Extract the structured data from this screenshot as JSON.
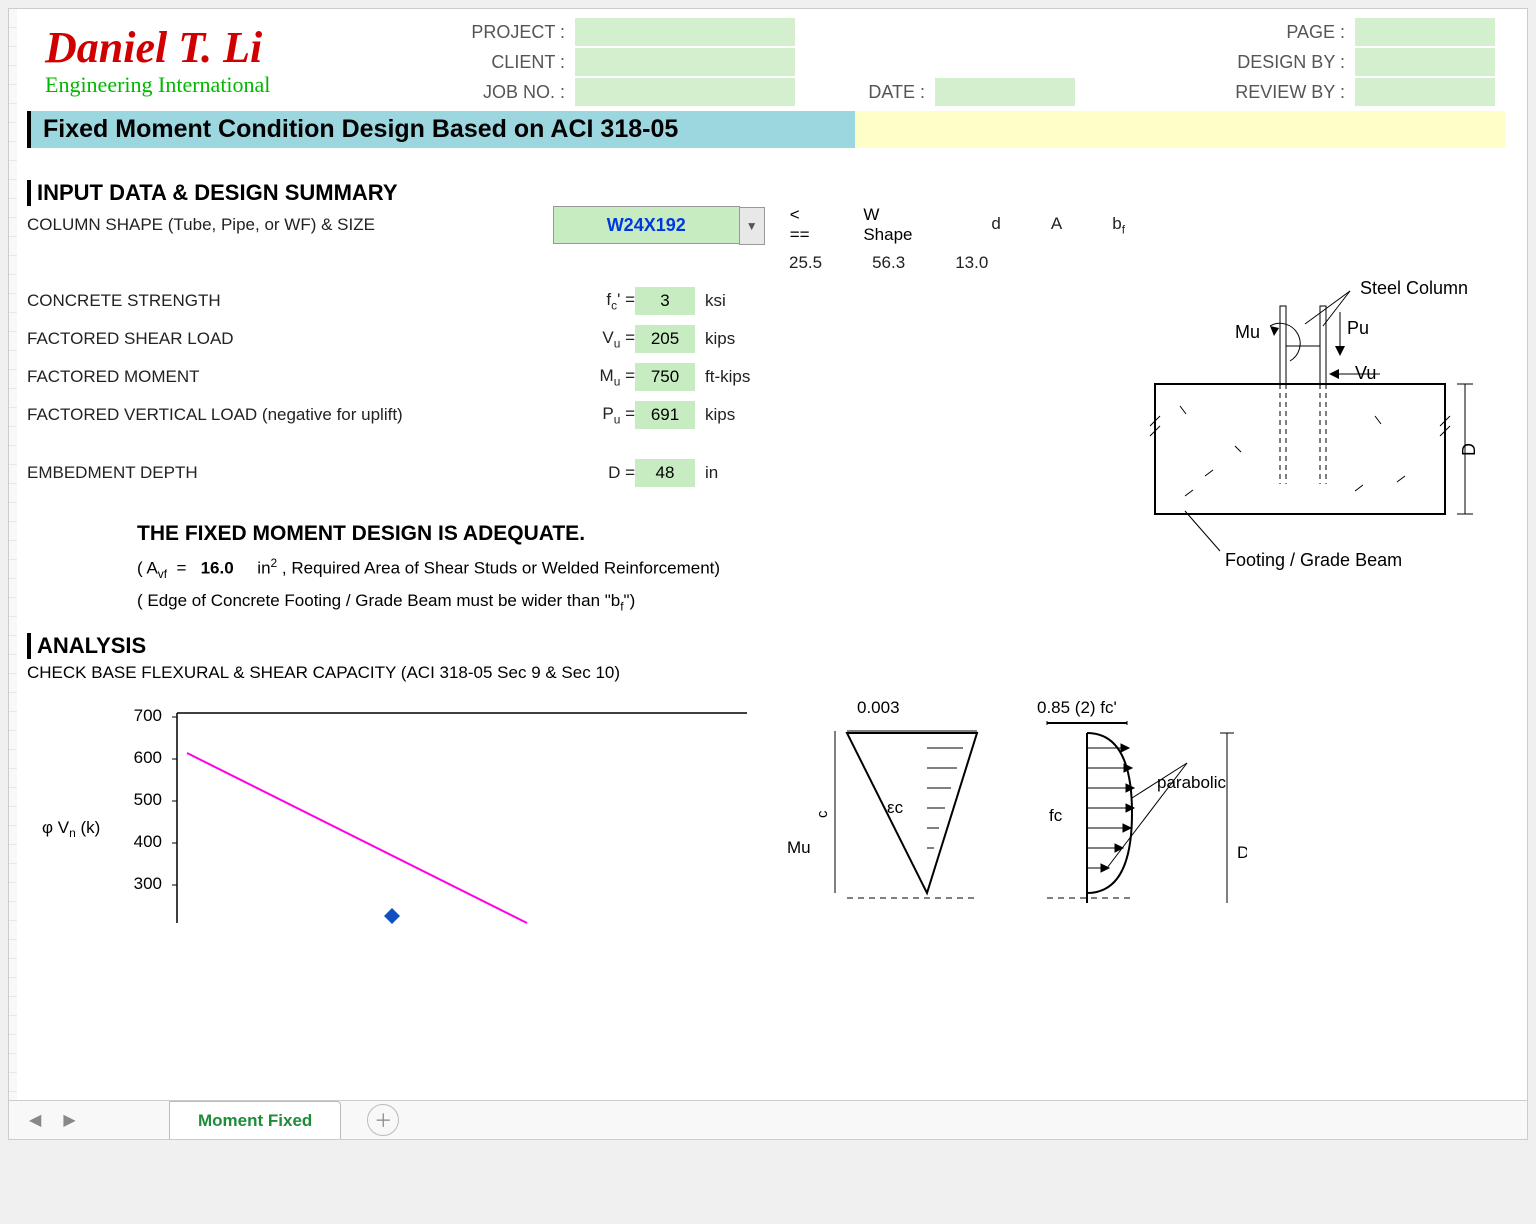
{
  "logo": {
    "name": "Daniel T. Li",
    "tagline": "Engineering International"
  },
  "header": {
    "project_label": "PROJECT :",
    "client_label": "CLIENT :",
    "jobno_label": "JOB NO. :",
    "date_label": "DATE :",
    "page_label": "PAGE :",
    "designby_label": "DESIGN BY :",
    "reviewby_label": "REVIEW BY :",
    "project": "",
    "client": "",
    "jobno": "",
    "date": "",
    "page": "",
    "designby": "",
    "reviewby": ""
  },
  "title": "Fixed Moment Condition Design Based on ACI 318-05",
  "sections": {
    "input": "INPUT DATA & DESIGN SUMMARY",
    "analysis": "ANALYSIS",
    "analysis_sub": "CHECK BASE FLEXURAL & SHEAR CAPACITY (ACI 318-05 Sec 9 & Sec 10)"
  },
  "inputs": {
    "shape_label": "COLUMN SHAPE (Tube, Pipe, or WF) & SIZE",
    "shape_value": "W24X192",
    "shape_arrow": "< ==",
    "shape_type": "W Shape",
    "props_hdr": {
      "d": "d",
      "A": "A",
      "bf": "bf"
    },
    "props_val": {
      "d": "25.5",
      "A": "56.3",
      "bf": "13.0"
    },
    "fc": {
      "label": "CONCRETE STRENGTH",
      "sym": "fc' =",
      "val": "3",
      "unit": "ksi"
    },
    "vu": {
      "label": "FACTORED SHEAR LOAD",
      "sym": "Vu =",
      "val": "205",
      "unit": "kips"
    },
    "mu": {
      "label": "FACTORED MOMENT",
      "sym": "Mu =",
      "val": "750",
      "unit": "ft-kips"
    },
    "pu": {
      "label": "FACTORED VERTICAL LOAD (negative for uplift)",
      "sym": "Pu =",
      "val": "691",
      "unit": "kips"
    },
    "d": {
      "label": "EMBEDMENT DEPTH",
      "sym": "D =",
      "val": "48",
      "unit": "in"
    }
  },
  "result": {
    "headline": "THE FIXED MOMENT DESIGN IS ADEQUATE.",
    "avf_prefix": "( Avf  =",
    "avf_value": "16.0",
    "avf_suffix": "in² , Required Area of Shear Studs or Welded Reinforcement)",
    "edge_note": "( Edge of Concrete Footing / Grade Beam must be wider than \"bf\")"
  },
  "diagram": {
    "steel_col": "Steel Column",
    "mu": "Mu",
    "pu": "Pu",
    "vu": "Vu",
    "footing": "Footing / Grade Beam",
    "d": "D"
  },
  "analysis_diag": {
    "top_left": "0.003",
    "top_right": "0.85 (2) fc'",
    "eps": "εc",
    "fc": "fc",
    "parabolic": "parabolic",
    "mu": "Mu",
    "c": "c",
    "d": "D"
  },
  "chart_data": {
    "type": "line",
    "ylabel": "φ Vn (k)",
    "ylim": [
      200,
      700
    ],
    "yticks": [
      300,
      400,
      500,
      600,
      700
    ],
    "series": [
      {
        "name": "phiVn",
        "color": "#ff00e6",
        "x": [
          0,
          100
        ],
        "y": [
          610,
          240
        ]
      }
    ],
    "marker": {
      "x": 58,
      "y": 265,
      "symbol": "diamond",
      "color": "#1050c0"
    }
  },
  "tabs": {
    "active": "Moment Fixed"
  }
}
